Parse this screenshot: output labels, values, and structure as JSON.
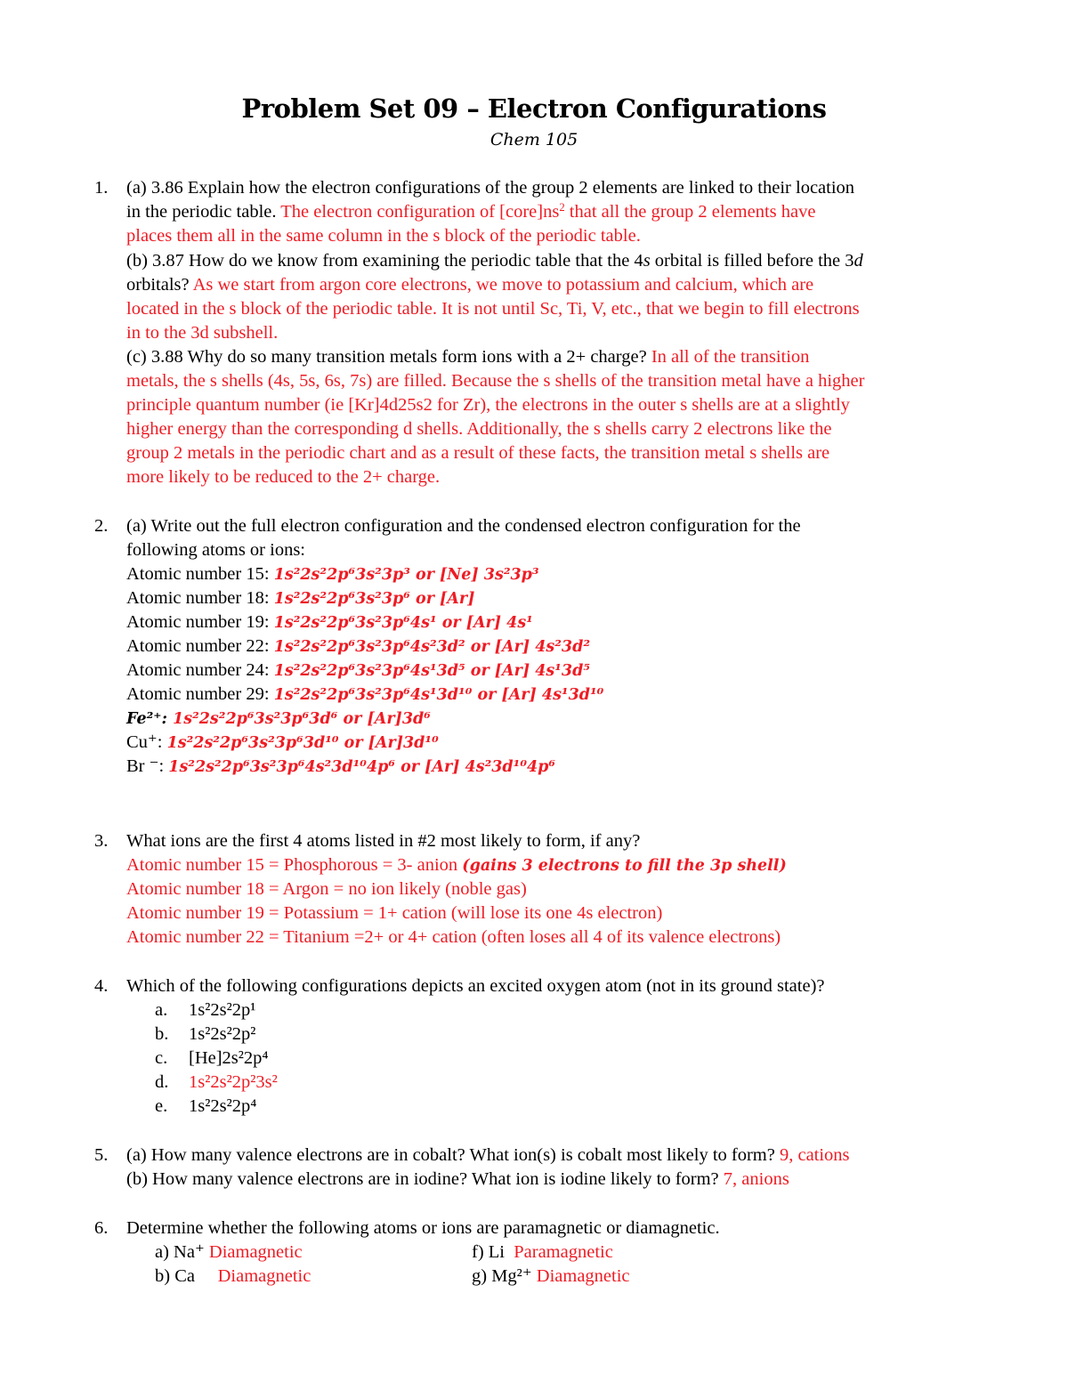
{
  "header": {
    "title": "Problem Set 09 – Electron Configurations",
    "subtitle": "Chem 105"
  },
  "q1": {
    "number": "1.",
    "a_question": "(a) 3.86 Explain how the electron configurations of the group 2 elements are linked to their location",
    "a_question_2": "in the periodic table.",
    "a_answer_1": " The electron configuration of [core]ns",
    "a_answer_sup": "2",
    "a_answer_2": " that all the group 2 elements have",
    "a_answer_3": "places them all in the same column in the s block of the periodic table.",
    "b_question_1": "(b) 3.87 How do we know from examining the periodic table that the 4",
    "b_question_s": "s",
    "b_question_2": " orbital is filled before the 3",
    "b_question_d": "d",
    "b_question_3": "orbitals?",
    "b_answer_1": " As we start from argon core electrons, we move to potassium and calcium, which are",
    "b_answer_2": "located in the s block of the periodic table. It is not until Sc, Ti, V, etc., that we begin to fill electrons",
    "b_answer_3": "in to the 3d subshell.",
    "c_question": "(c) 3.88 Why do so many transition metals form ions with a 2+ charge?",
    "c_answer_1": " In all of the transition",
    "c_answer_2": "metals, the s shells (4s, 5s, 6s, 7s) are filled. Because the s shells of the transition metal have a higher",
    "c_answer_3": "principle quantum number (ie [Kr]4d25s2 for Zr), the electrons in the outer s shells are at a slightly",
    "c_answer_4": "higher energy than the corresponding d shells. Additionally, the s shells carry 2 electrons like the",
    "c_answer_5": "group 2 metals in the periodic chart and as a result of these facts, the transition metal s shells are",
    "c_answer_6": "more likely to be reduced to the 2+ charge."
  },
  "q2": {
    "number": "2.",
    "question_1": "(a) Write out the full electron configuration and the condensed electron configuration for the",
    "question_2": "following atoms or ions:",
    "items": [
      {
        "label": "Atomic number 15: ",
        "full": "1s²2s²2p⁶3s²3p³",
        "condensed": "[Ne] 3s²3p³"
      },
      {
        "label": "Atomic number 18: ",
        "full": "1s²2s²2p⁶3s²3p⁶",
        "condensed": "[Ar]"
      },
      {
        "label": "Atomic number 19: ",
        "full": "1s²2s²2p⁶3s²3p⁶4s¹",
        "condensed": "[Ar] 4s¹"
      },
      {
        "label": "Atomic number 22: ",
        "full": "1s²2s²2p⁶3s²3p⁶4s²3d²",
        "condensed": "[Ar] 4s²3d²"
      },
      {
        "label": "Atomic number 24: ",
        "full": "1s²2s²2p⁶3s²3p⁶4s¹3d⁵",
        "condensed": "[Ar] 4s¹3d⁵"
      },
      {
        "label": "Atomic number 29: ",
        "full": "1s²2s²2p⁶3s²3p⁶4s¹3d¹⁰",
        "condensed": "[Ar] 4s¹3d¹⁰"
      },
      {
        "label": "Fe²⁺: ",
        "full": "1s²2s²2p⁶3s²3p⁶3d⁶",
        "condensed": "[Ar]3d⁶"
      },
      {
        "label": "Cu⁺: ",
        "full": "1s²2s²2p⁶3s²3p⁶3d¹⁰",
        "condensed": "[Ar]3d¹⁰"
      },
      {
        "label": "Br ⁻: ",
        "full": "1s²2s²2p⁶3s²3p⁶4s²3d¹⁰4p⁶",
        "condensed": "[Ar] 4s²3d¹⁰4p⁶"
      }
    ],
    "or": " or "
  },
  "q3": {
    "number": "3.",
    "question": "What ions are the first 4 atoms listed in #2 most likely to form, if any?",
    "answers": [
      {
        "text": "Atomic number 15 = Phosphorous = 3- anion ",
        "note": "(gains 3 electrons to fill the 3p shell)"
      },
      {
        "text": "Atomic number 18 = Argon = no ion likely (noble gas)",
        "note": ""
      },
      {
        "text": "Atomic number 19 = Potassium = 1+ cation (will lose its one 4s electron)",
        "note": ""
      },
      {
        "text": "Atomic number 22 = Titanium =2+ or 4+ cation (often loses all 4 of its valence electrons)",
        "note": ""
      }
    ]
  },
  "q4": {
    "number": "4.",
    "question": "Which of the following configurations depicts an excited oxygen atom (not in its ground state)?",
    "options": [
      {
        "letter": "a.",
        "value": "1s²2s²2p¹",
        "correct": false
      },
      {
        "letter": "b.",
        "value": "1s²2s²2p²",
        "correct": false
      },
      {
        "letter": "c.",
        "value": "[He]2s²2p⁴",
        "correct": false
      },
      {
        "letter": "d.",
        "value": "1s²2s²2p²3s²",
        "correct": true
      },
      {
        "letter": "e.",
        "value": "1s²2s²2p⁴",
        "correct": false
      }
    ]
  },
  "q5": {
    "number": "5.",
    "a_question": "(a) How many valence electrons are in cobalt? What ion(s) is cobalt most likely to form?",
    "a_answer": " 9, cations",
    "b_question": "(b) How many valence electrons are in iodine? What ion is iodine likely to form?",
    "b_answer": " 7, anions"
  },
  "q6": {
    "number": "6.",
    "question": "Determine whether the following atoms or ions are paramagnetic or diamagnetic.",
    "items": [
      {
        "label": "a) Na⁺",
        "answer": " Diamagnetic"
      },
      {
        "label": "b) Ca",
        "answer": "     Diamagnetic"
      },
      {
        "label": "f) Li",
        "answer": "  Paramagnetic"
      },
      {
        "label": "g) Mg²⁺",
        "answer": " Diamagnetic"
      }
    ]
  }
}
